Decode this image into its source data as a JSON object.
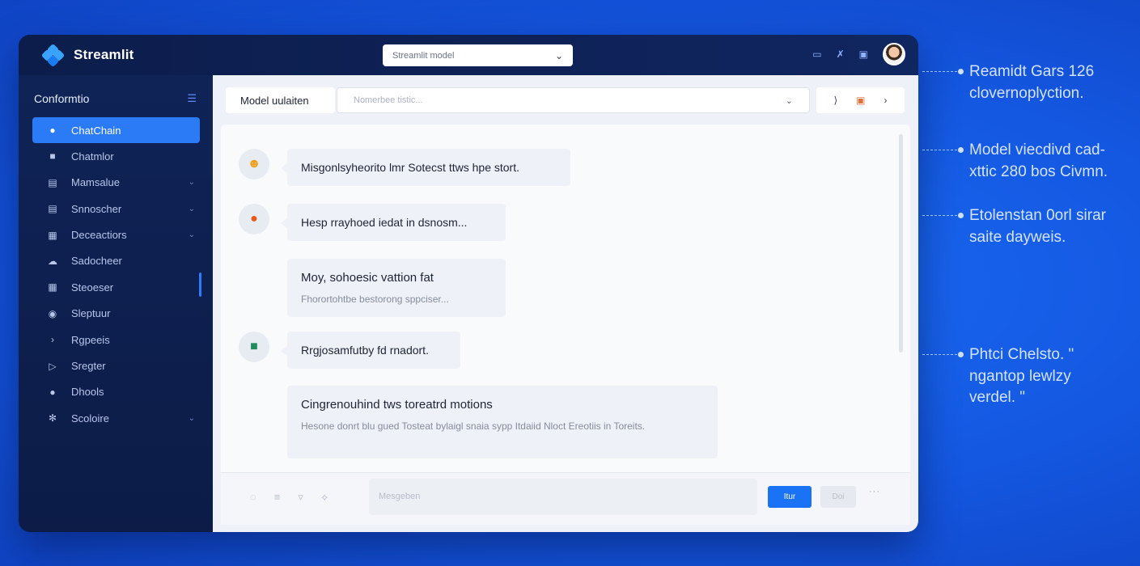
{
  "app": {
    "name": "Streamlit"
  },
  "top_select": {
    "value": "Streamlit model"
  },
  "sidebar": {
    "header": "Conformtio",
    "items": [
      {
        "label": "ChatChain",
        "icon": "chat-icon",
        "active": true
      },
      {
        "label": "Chatmlor",
        "icon": "book-icon",
        "chevron": false
      },
      {
        "label": "Mamsalue",
        "icon": "database-icon",
        "chevron": true
      },
      {
        "label": "Snnoscher",
        "icon": "list-icon",
        "chevron": true
      },
      {
        "label": "Deceactiors",
        "icon": "table-icon",
        "chevron": true
      },
      {
        "label": "Sadocheer",
        "icon": "cloud-icon",
        "chevron": false
      },
      {
        "label": "Steoeser",
        "icon": "grid-icon",
        "chevron": false
      },
      {
        "label": "Sleptuur",
        "icon": "globe-icon",
        "chevron": false
      },
      {
        "label": "Rgpeeis",
        "icon": "chevron-right-icon",
        "chevron": false
      },
      {
        "label": "Sregter",
        "icon": "play-icon",
        "chevron": false
      },
      {
        "label": "Dhools",
        "icon": "circle-icon",
        "chevron": false
      },
      {
        "label": "Scoloire",
        "icon": "gear-icon",
        "chevron": true
      }
    ]
  },
  "model_bar": {
    "label": "Model uulaiten",
    "placeholder": "Nomerbee tistic...",
    "icons": [
      "brace-icon",
      "trash-icon",
      "next-icon"
    ]
  },
  "messages": [
    {
      "text": "Misgonlsyheorito lmr Sotecst ttws hpe stort.",
      "avatar": "bot-orange-icon"
    },
    {
      "text": "Hesp rrayhoed iedat in dsnosm...",
      "avatar": "user-icon"
    },
    {
      "title": "Moy, sohoesic vattion fat",
      "sub": "Fhorortohtbe bestorong sppciser..."
    },
    {
      "text": "Rrgjosamfutby fd rnadort.",
      "avatar": "bot-green-icon"
    },
    {
      "title": "Cingrenouhind tws toreatrd motions",
      "sub": "Hesone donrt blu gued Tosteat bylaigl snaia sypp Itdaiid Nloct Ereotiis in Toreits."
    }
  ],
  "composer": {
    "placeholder": "Mesgeben",
    "send_label": "Itur",
    "stop_label": "Doi",
    "more_label": "···"
  },
  "callouts": [
    {
      "line1": "Reamidt Gars 126",
      "line2": "clovernoplyction."
    },
    {
      "line1": "Model viecdivd cad-",
      "line2": "xttic 280 bos Civmn."
    },
    {
      "line1": "Etolenstan 0orl sirar",
      "line2": "saite dayweis."
    },
    {
      "line1": "Phtci Chelsto. \"",
      "line2": "ngantop lewlzy",
      "line3": "verdel. \""
    }
  ],
  "colors": {
    "accent": "#2b7bf6",
    "sidebar": "#0f2356",
    "background": "#1457e0"
  }
}
